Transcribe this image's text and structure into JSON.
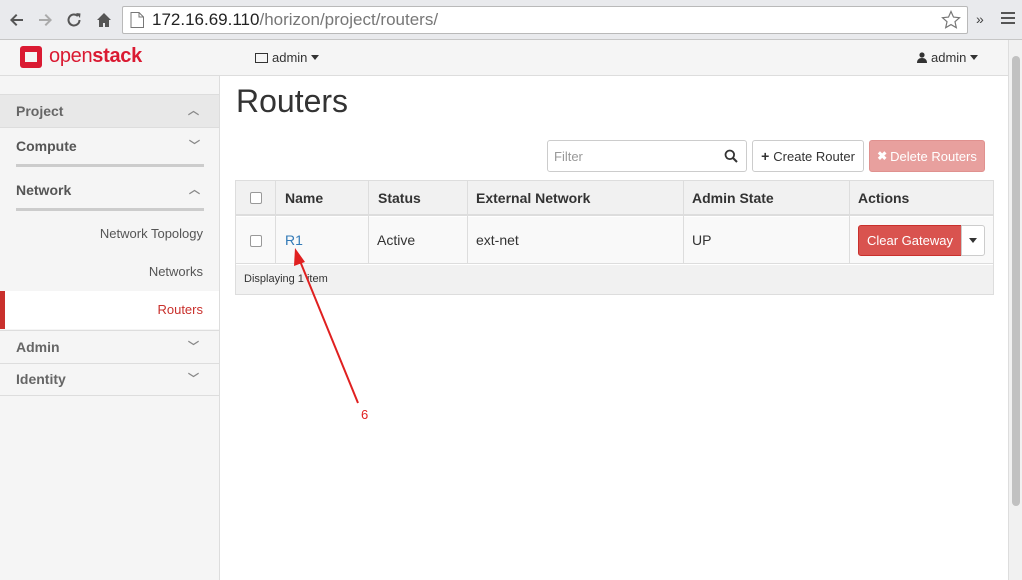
{
  "browser": {
    "url_host": "172.16.69.110",
    "url_path": "/horizon/project/routers/",
    "more_label": "»"
  },
  "header": {
    "logo_open": "open",
    "logo_stack": "stack",
    "project_label": "admin",
    "user_label": "admin"
  },
  "sidebar": {
    "project": "Project",
    "compute": "Compute",
    "network": "Network",
    "network_items": [
      "Network Topology",
      "Networks",
      "Routers"
    ],
    "admin": "Admin",
    "identity": "Identity"
  },
  "main": {
    "title": "Routers",
    "filter_placeholder": "Filter",
    "create_label": "Create Router",
    "delete_label": "Delete Routers"
  },
  "table": {
    "columns": [
      "Name",
      "Status",
      "External Network",
      "Admin State",
      "Actions"
    ],
    "rows": [
      {
        "name": "R1",
        "status": "Active",
        "external_network": "ext-net",
        "admin_state": "UP",
        "action": "Clear Gateway"
      }
    ],
    "footer": "Displaying 1 item"
  },
  "annotation": {
    "label": "6",
    "color": "#e02020"
  },
  "colors": {
    "brand": "#da1a32",
    "danger": "#d9534f",
    "link": "#337ab7"
  }
}
